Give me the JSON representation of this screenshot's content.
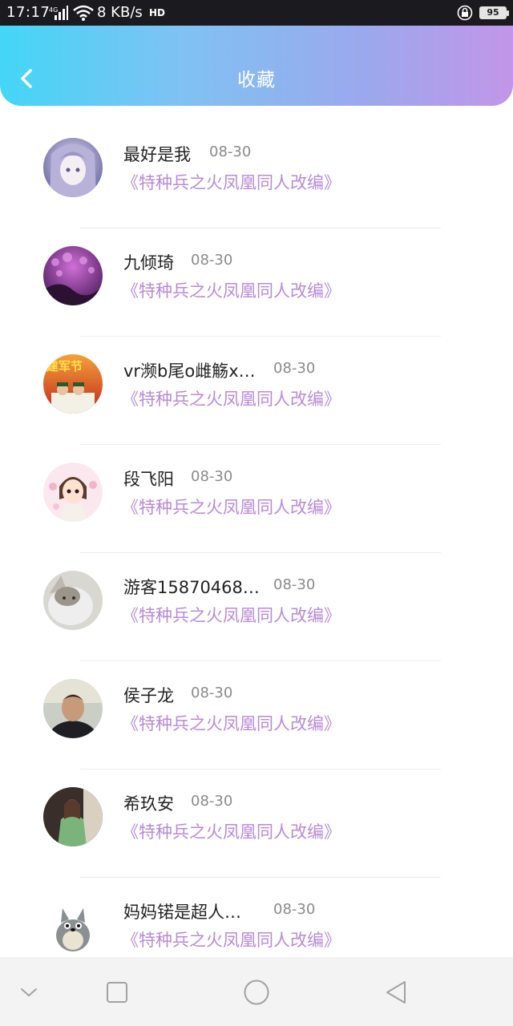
{
  "status_bar": {
    "time": "17:17",
    "network": "4G",
    "speed": "8 KB/s",
    "hd_badge": "HD",
    "battery": "95"
  },
  "header": {
    "title": "收藏",
    "back_icon": "chevron-left-icon",
    "gradient": [
      "#43d6f6",
      "#c296e8"
    ]
  },
  "items": [
    {
      "name": "最好是我",
      "date": "08-30",
      "book": "《特种兵之火凤凰同人改编》"
    },
    {
      "name": "九倾琦",
      "date": "08-30",
      "book": "《特种兵之火凤凰同人改编》"
    },
    {
      "name": "vr濒b尾o雌觞x…",
      "date": "08-30",
      "book": "《特种兵之火凤凰同人改编》"
    },
    {
      "name": "段飞阳",
      "date": "08-30",
      "book": "《特种兵之火凤凰同人改编》"
    },
    {
      "name": "游客15870468…",
      "date": "08-30",
      "book": "《特种兵之火凤凰同人改编》"
    },
    {
      "name": "侯子龙",
      "date": "08-30",
      "book": "《特种兵之火凤凰同人改编》"
    },
    {
      "name": "希玖安",
      "date": "08-30",
      "book": "《特种兵之火凤凰同人改编》"
    },
    {
      "name": "妈妈锘是超人…",
      "date": "08-30",
      "book": "《特种兵之火凤凰同人改编》"
    }
  ],
  "avatar_badge": "建军节",
  "colors": {
    "book_title": "#b88ad8",
    "date": "#8a8a8a",
    "name": "#222222"
  }
}
